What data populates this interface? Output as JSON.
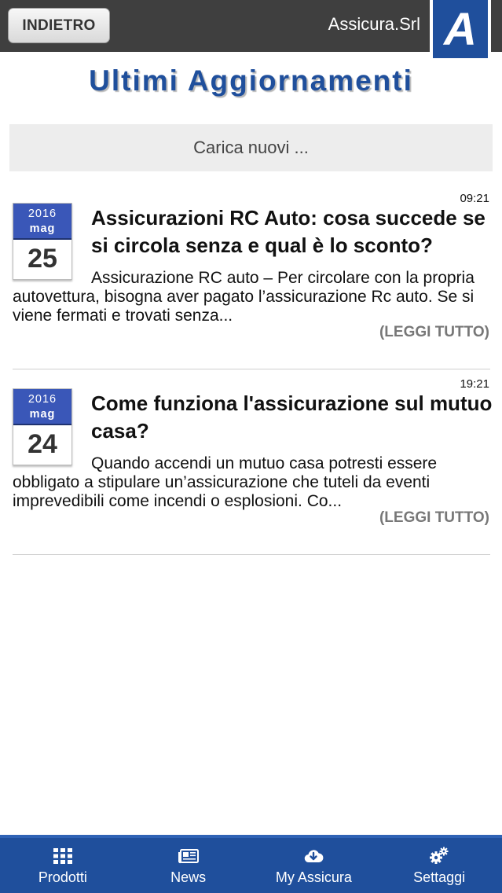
{
  "topbar": {
    "back_label": "INDIETRO",
    "brand_name": "Assicura.Srl",
    "logo_letter": "A"
  },
  "page": {
    "title": "Ultimi Aggiornamenti",
    "load_new": "Carica nuovi ..."
  },
  "news": [
    {
      "time": "09:21",
      "year": "2016",
      "month": "mag",
      "day": "25",
      "title": "Assicurazioni RC Auto: cosa succede se si circola senza e qual è lo sconto?",
      "excerpt": "Assicurazione RC auto – Per circolare con la propria autovettura, bisogna aver pagato l’assicurazione Rc auto. Se si viene fermati e trovati senza...",
      "read_more": "(LEGGI TUTTO)"
    },
    {
      "time": "19:21",
      "year": "2016",
      "month": "mag",
      "day": "24",
      "title": "Come funziona l'assicurazione sul mutuo casa?",
      "excerpt": "Quando accendi un mutuo casa potresti essere obbligato a stipulare un’assicurazione che tuteli da eventi imprevedibili come incendi o esplosioni. Co...",
      "read_more": "(LEGGI TUTTO)"
    }
  ],
  "tabbar": {
    "items": [
      {
        "label": "Prodotti",
        "icon": "grid-icon"
      },
      {
        "label": "News",
        "icon": "newspaper-icon"
      },
      {
        "label": "My Assicura",
        "icon": "cloud-download-icon"
      },
      {
        "label": "Settaggi",
        "icon": "gears-icon"
      }
    ]
  },
  "colors": {
    "brand_blue": "#1f4f9c",
    "topbar_bg": "#3f3f3f",
    "calendar_header": "#3a57b8"
  }
}
